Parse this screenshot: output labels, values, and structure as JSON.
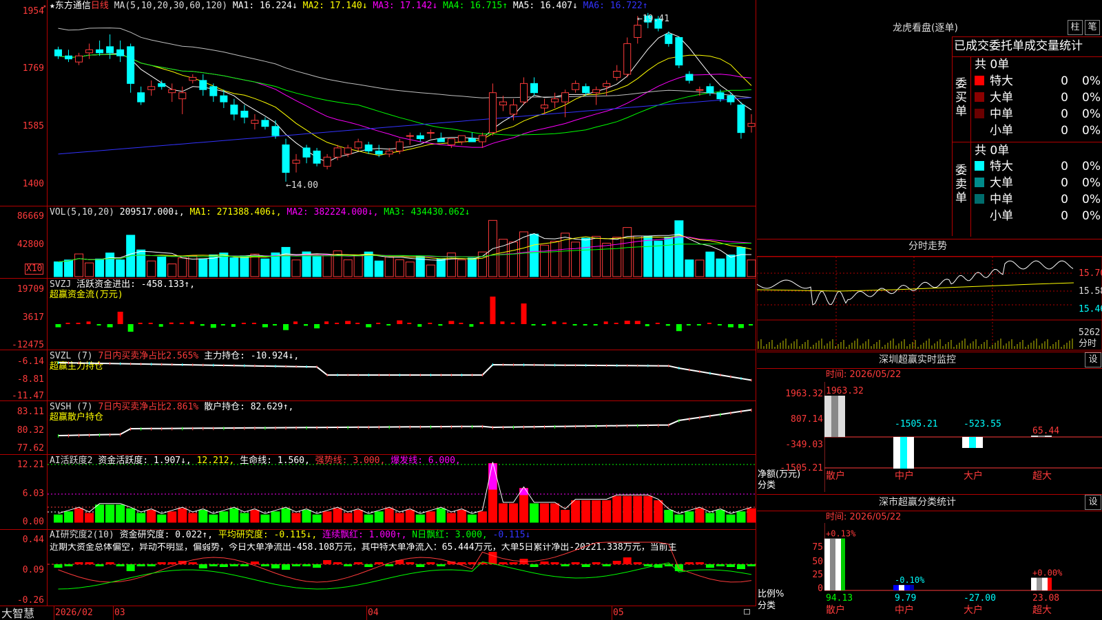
{
  "main": {
    "stock_name": "东方通信",
    "period": "日线",
    "ma_label": "MA(5,10,20,30,60,120)",
    "ma_items": [
      {
        "text": "MA1: 16.224↓",
        "color": "#ffffff"
      },
      {
        "text": "MA2: 17.140↓",
        "color": "#ffff00"
      },
      {
        "text": "MA3: 17.142↓",
        "color": "#ff00ff"
      },
      {
        "text": "MA4: 16.715↑",
        "color": "#00ff00"
      },
      {
        "text": "MA5: 16.407↓",
        "color": "#ffffff"
      },
      {
        "text": "MA6: 16.722↑",
        "color": "#3333ff"
      }
    ],
    "y_ticks": [
      "1954",
      "1769",
      "1585",
      "1400"
    ],
    "high_label": "19.41",
    "low_label": "14.00"
  },
  "vol": {
    "label": "VOL(5,10,20)",
    "items": [
      {
        "text": "209517.000↓,",
        "color": "#ffffff"
      },
      {
        "text": "MA1: 271388.406↓,",
        "color": "#ffff00"
      },
      {
        "text": "MA2: 382224.000↓,",
        "color": "#ff00ff"
      },
      {
        "text": "MA3: 434430.062↓",
        "color": "#00ff00"
      }
    ],
    "y_ticks": [
      "86669",
      "42800"
    ],
    "unit": "X10"
  },
  "svzj": {
    "label": "SVZJ",
    "value_text": "活跃资金进出: -458.133↑,",
    "title": "超赢资金流(万元)",
    "y_ticks": [
      "19709",
      "3617",
      "-12475"
    ]
  },
  "svzl": {
    "label": "SVZL (7)",
    "ratio_text": "7日内买卖净占比2.565%",
    "value_text": "主力持仓: -10.924↓,",
    "title": "超赢主力持仓",
    "y_ticks": [
      "-6.14",
      "-8.81",
      "-11.47"
    ]
  },
  "svsh": {
    "label": "SVSH (7)",
    "ratio_text": "7日内买卖净占比2.861%",
    "value_text": "散户持仓: 82.629↑,",
    "title": "超赢散户持仓",
    "y_ticks": [
      "83.11",
      "80.32",
      "77.62"
    ]
  },
  "ai_active": {
    "label": "AI活跃度2",
    "items": [
      {
        "text": "资金活跃度: 1.907↓,",
        "color": "#ffffff"
      },
      {
        "text": "12.212,",
        "color": "#ffff00"
      },
      {
        "text": "生命线: 1.560,",
        "color": "#ffffff"
      },
      {
        "text": "强势线: 3.000,",
        "color": "#ff3b3b"
      },
      {
        "text": "爆发线: 6.000,",
        "color": "#ff00ff"
      }
    ],
    "y_ticks": [
      "12.21",
      "6.03",
      "0.00"
    ]
  },
  "ai_research": {
    "label": "AI研究度2(10)",
    "items": [
      {
        "text": "资金研究度: 0.022↑,",
        "color": "#ffffff"
      },
      {
        "text": "平均研究度: -0.115↓,",
        "color": "#ffff00"
      },
      {
        "text": "连续飘红: 1.000↑,",
        "color": "#ff00ff"
      },
      {
        "text": "N日飘红: 3.000,",
        "color": "#00ff00"
      },
      {
        "text": "-0.115↓",
        "color": "#3333ff"
      }
    ],
    "comment": "近期大资金总体偏空，异动不明显，偏弱势，今日大单净流出-458.108万元，其中特大单净流入：65.444万元，大单5日累计净出-20221.338万元，当前主",
    "y_ticks": [
      "0.44",
      "0.09",
      "-0.26"
    ]
  },
  "bottom_bar": {
    "brand": "大智慧",
    "dates": [
      "2026/02",
      "03",
      "04",
      "05"
    ]
  },
  "right": {
    "lhb_title": "龙虎看盘(逐单)",
    "lhb_btn1": "柱",
    "lhb_btn2": "笔",
    "stats_header": "已成交委托单成交量统计",
    "buy_side": "委买单",
    "sell_side": "委卖单",
    "buy_total": "共 0单",
    "sell_total": "共 0单",
    "buy_rows": [
      {
        "name": "特大",
        "count": "0",
        "pct": "0%",
        "color": "#ff0000"
      },
      {
        "name": "大单",
        "count": "0",
        "pct": "0%",
        "color": "#8b0000"
      },
      {
        "name": "中单",
        "count": "0",
        "pct": "0%",
        "color": "#6b0000"
      },
      {
        "name": "小单",
        "count": "0",
        "pct": "0%",
        "color": ""
      }
    ],
    "sell_rows": [
      {
        "name": "特大",
        "count": "0",
        "pct": "0%",
        "color": "#00ffff"
      },
      {
        "name": "大单",
        "count": "0",
        "pct": "0%",
        "color": "#008b8b"
      },
      {
        "name": "中单",
        "count": "0",
        "pct": "0%",
        "color": "#006d6d"
      },
      {
        "name": "小单",
        "count": "0",
        "pct": "0%",
        "color": ""
      }
    ],
    "intraday_title": "分时走势",
    "intraday_prices": [
      "15.70",
      "15.58",
      "15.46"
    ],
    "intraday_vol": "5262",
    "intraday_vol_label": "分时",
    "sz_title": "深圳超赢实时监控",
    "sz_btn": "设",
    "sz_time": "时间: 2026/05/22",
    "sz_yticks": [
      "1963.32",
      "807.14",
      "-349.03",
      "-1505.21"
    ],
    "sz_unit": "净额(万元)",
    "sz_cat_label": "分类",
    "sz_bars": [
      {
        "name": "散户",
        "value": "1963.32"
      },
      {
        "name": "中户",
        "value": "-1505.21"
      },
      {
        "name": "大户",
        "value": "-523.55"
      },
      {
        "name": "超大",
        "value": "65.44"
      }
    ],
    "fl_title": "深市超赢分类统计",
    "fl_btn": "设",
    "fl_time": "时间: 2026/05/22",
    "fl_yticks": [
      "75",
      "50",
      "25",
      "0"
    ],
    "fl_unit": "比例%",
    "fl_cat_label": "分类",
    "fl_bars": [
      {
        "name": "散户",
        "change": "+0.13%",
        "value": "94.13"
      },
      {
        "name": "中户",
        "change": "-0.10%",
        "value": "9.79"
      },
      {
        "name": "大户",
        "change": "",
        "value": "-27.00"
      },
      {
        "name": "超大",
        "change": "+0.00%",
        "value": "23.08"
      }
    ]
  },
  "chart_data": {
    "type": "candlestick",
    "price_axis": [
      14.0,
      19.54
    ],
    "ohlc_note": "daily candles 2026/02 - 2026/05",
    "candles": [
      [
        18.3,
        18.4,
        18.0,
        18.1
      ],
      [
        18.1,
        18.3,
        17.9,
        18.0
      ],
      [
        17.9,
        18.2,
        17.8,
        18.1
      ],
      [
        18.2,
        18.5,
        18.0,
        18.3
      ],
      [
        18.3,
        18.6,
        18.1,
        18.2
      ],
      [
        18.4,
        18.8,
        18.0,
        18.2
      ],
      [
        18.3,
        18.6,
        17.9,
        18.1
      ],
      [
        18.4,
        18.5,
        16.9,
        17.2
      ],
      [
        16.9,
        17.1,
        16.5,
        16.6
      ],
      [
        17.0,
        17.3,
        16.8,
        17.1
      ],
      [
        17.2,
        17.3,
        17.0,
        17.1
      ],
      [
        16.9,
        17.2,
        16.6,
        17.0
      ],
      [
        16.7,
        17.1,
        16.2,
        16.9
      ],
      [
        17.3,
        17.5,
        17.2,
        17.4
      ],
      [
        17.3,
        17.5,
        16.8,
        17.0
      ],
      [
        17.1,
        17.2,
        16.6,
        16.8
      ],
      [
        16.8,
        17.0,
        16.4,
        16.6
      ],
      [
        16.5,
        16.7,
        16.0,
        16.2
      ],
      [
        16.3,
        16.5,
        15.9,
        16.1
      ],
      [
        15.9,
        16.2,
        15.7,
        16.0
      ],
      [
        16.0,
        16.1,
        15.7,
        15.8
      ],
      [
        15.8,
        16.0,
        15.4,
        15.5
      ],
      [
        15.2,
        15.4,
        14.0,
        14.3
      ],
      [
        14.6,
        14.9,
        14.3,
        14.7
      ],
      [
        15.1,
        15.2,
        14.6,
        14.8
      ],
      [
        15.0,
        15.1,
        14.5,
        14.6
      ],
      [
        14.5,
        14.9,
        14.4,
        14.8
      ],
      [
        14.8,
        15.2,
        14.7,
        15.1
      ],
      [
        14.9,
        15.2,
        14.8,
        15.1
      ],
      [
        15.1,
        15.4,
        15.0,
        15.3
      ],
      [
        15.2,
        15.3,
        14.9,
        15.0
      ],
      [
        15.0,
        15.2,
        14.8,
        14.9
      ],
      [
        14.9,
        15.1,
        14.8,
        15.0
      ],
      [
        15.0,
        15.4,
        14.9,
        15.3
      ],
      [
        15.5,
        15.6,
        15.2,
        15.5
      ],
      [
        15.5,
        15.6,
        15.3,
        15.4
      ],
      [
        15.6,
        15.7,
        15.4,
        15.6
      ],
      [
        15.4,
        15.6,
        15.3,
        15.3
      ],
      [
        15.2,
        15.4,
        15.1,
        15.4
      ],
      [
        15.3,
        15.5,
        15.2,
        15.5
      ],
      [
        15.4,
        15.6,
        15.3,
        15.3
      ],
      [
        15.3,
        15.6,
        15.1,
        15.5
      ],
      [
        15.6,
        17.2,
        15.5,
        16.9
      ],
      [
        16.5,
        16.8,
        16.3,
        16.6
      ],
      [
        16.2,
        16.7,
        16.0,
        16.5
      ],
      [
        16.6,
        17.4,
        16.5,
        17.2
      ],
      [
        17.2,
        17.4,
        16.8,
        16.9
      ],
      [
        16.4,
        16.7,
        16.2,
        16.5
      ],
      [
        16.6,
        16.9,
        16.4,
        16.7
      ],
      [
        16.6,
        17.0,
        16.1,
        16.9
      ],
      [
        17.0,
        17.3,
        16.9,
        17.2
      ],
      [
        17.1,
        17.2,
        16.8,
        16.9
      ],
      [
        16.9,
        17.1,
        16.5,
        17.0
      ],
      [
        17.1,
        17.3,
        16.8,
        17.2
      ],
      [
        17.4,
        17.8,
        17.3,
        17.6
      ],
      [
        17.5,
        18.7,
        17.4,
        18.5
      ],
      [
        18.7,
        19.4,
        18.5,
        19.1
      ],
      [
        19.4,
        19.5,
        19.0,
        19.2
      ],
      [
        19.3,
        19.4,
        18.9,
        19.0
      ],
      [
        18.8,
        18.9,
        18.4,
        18.5
      ],
      [
        18.7,
        18.7,
        17.7,
        17.8
      ],
      [
        17.5,
        17.6,
        17.2,
        17.3
      ],
      [
        17.0,
        17.1,
        16.8,
        17.0
      ],
      [
        17.1,
        17.2,
        16.8,
        16.9
      ],
      [
        16.9,
        17.0,
        16.6,
        16.7
      ],
      [
        16.8,
        16.9,
        16.5,
        16.6
      ],
      [
        16.5,
        16.6,
        15.4,
        15.6
      ],
      [
        15.8,
        16.2,
        15.6,
        15.9
      ]
    ]
  }
}
